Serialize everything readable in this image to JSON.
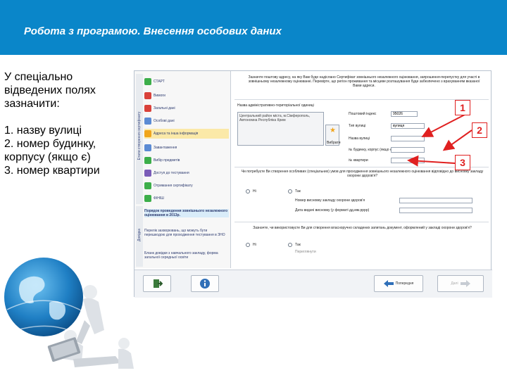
{
  "header": {
    "title": "Робота з програмою. Внесення особових даних"
  },
  "instructions": {
    "lines1": [
      "У спеціально",
      "відведених полях",
      "зазначити:"
    ],
    "lines2": [
      "1. назву вулиці",
      "2. номер будинку,",
      "корпусу (якщо є)",
      "3. номер квартири"
    ]
  },
  "sidebar": {
    "vertical_label": "Етапи створення сертифікату",
    "items": [
      {
        "label": "СТАРТ",
        "color": "#3cae4a"
      },
      {
        "label": "Вимоги",
        "color": "#d9413a"
      },
      {
        "label": "Загальні дані",
        "color": "#d9413a"
      },
      {
        "label": "Особові дані",
        "color": "#5b8bd4"
      },
      {
        "label": "Адреса та інша інформація",
        "color": "#f0a51c"
      },
      {
        "label": "Завантаження",
        "color": "#5b8bd4"
      },
      {
        "label": "Вибір предметів",
        "color": "#3cae4a"
      },
      {
        "label": "Доступ до тестування",
        "color": "#7a5cb8"
      },
      {
        "label": "Отримання сертифікату",
        "color": "#3cae4a"
      },
      {
        "label": "ФІНІШ",
        "color": "#3cae4a"
      }
    ],
    "info_label": "Довідка",
    "info_items": [
      "Порядок проведення зовнішнього незалежного оцінювання в 2013р.",
      "Перелік захворювань, що можуть бути перешкодою для проходження тестування в ЗНО",
      "Бланк довідки з навчального закладу, форма загальної середньої освіти"
    ]
  },
  "form": {
    "intro": "Зазначте поштову адресу, на яку Вам буде надіслано Сертифікат зовнішнього незалежного оцінювання, запрошення-перепустку для участі в зовнішньому незалежному оцінюванні. Перевірте, що регіон проживання та місцеве розташування буде забезпечено з врахуванням вказаної Вами адреси.",
    "territory_label": "Назва адміністративно-територіальної одиниці",
    "territory_value": "Центральний район міста, м.Сімферополь, Автономна Республіка Крим",
    "choose_button": "Вибрати",
    "postcode_label": "Поштовий індекс",
    "postcode_value": "95026",
    "street_type_label": "Тип вулиці",
    "street_type_value": "вулиця",
    "street_name_label": "Назва вулиці",
    "house_label": "№ будинку, корпус (якщо є)",
    "apartment_label": "№ квартири",
    "question1": "Чи потребуєте Ви створення особливих (спеціальних) умов для проходження зовнішнього незалежного оцінювання відповідно до висновку закладу охорони здоров'я?",
    "no": "Ні",
    "yes": "Так",
    "doc_number_label": "Номер висновку закладу охорони здоров'я",
    "doc_date_label": "Дата видачі висновку (у форматі дд.мм.рррр)",
    "question2": "Зазначте, чи використовуєте Ви для створення власноручно складених запитань документ, оформлений у закладі охорони здоров'я?",
    "no2": "Ні",
    "yes2": "Так",
    "extra_label": "Переглянути"
  },
  "bottom_bar": {
    "prev_label": "Попередня",
    "next_label": "Далі"
  },
  "annotations": {
    "badge1": "1",
    "badge2": "2",
    "badge3": "3"
  },
  "colors": {
    "header_bg": "#0a86c9",
    "annotation": "#e02020"
  }
}
